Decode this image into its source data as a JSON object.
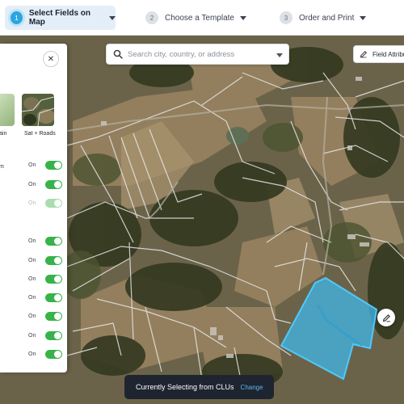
{
  "steps": [
    {
      "num": "1",
      "label": "Select Fields on Map"
    },
    {
      "num": "2",
      "label": "Choose a Template"
    },
    {
      "num": "3",
      "label": "Order and Print"
    }
  ],
  "search": {
    "placeholder": "Search city, country, or address"
  },
  "field_attributes": {
    "label": "Field Attribu"
  },
  "panel": {
    "close_icon": "close-icon",
    "basemaps": [
      {
        "label": "ain"
      },
      {
        "label": "Sat + Roads"
      }
    ],
    "partial_label": "m",
    "toggles": [
      {
        "label": "On",
        "state": "on"
      },
      {
        "label": "On",
        "state": "on"
      },
      {
        "label": "On",
        "state": "disabled"
      },
      {
        "label": "On",
        "state": "on"
      },
      {
        "label": "On",
        "state": "on"
      },
      {
        "label": "On",
        "state": "on"
      },
      {
        "label": "On",
        "state": "on"
      },
      {
        "label": "On",
        "state": "on"
      },
      {
        "label": "On",
        "state": "on"
      },
      {
        "label": "On",
        "state": "on"
      },
      {
        "label": "On",
        "state": "on"
      }
    ]
  },
  "status_bar": {
    "message": "Currently Selecting from CLUs",
    "action": "Change"
  },
  "colors": {
    "accent": "#2ba5e0",
    "toggle_on": "#37b34a",
    "selection_fill": "#3fb6e8",
    "status_bg": "#1e2430",
    "link": "#5bb7ee"
  },
  "icons": {
    "search": "search-icon",
    "dropdown": "chevron-down-icon",
    "edit": "pencil-icon"
  }
}
